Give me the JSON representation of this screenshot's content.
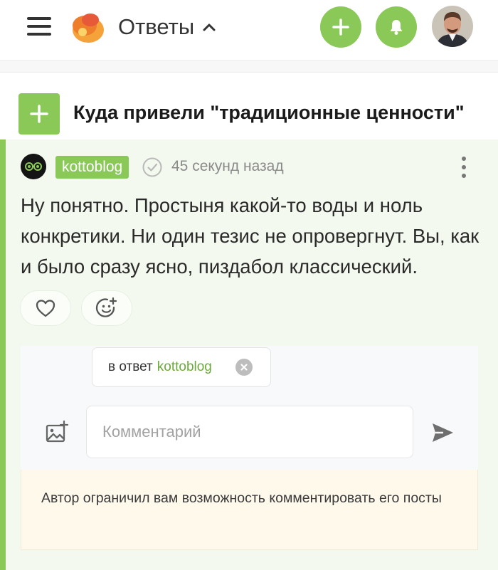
{
  "header": {
    "section_label": "Ответы",
    "colors": {
      "accent": "#8ac858"
    },
    "icons": [
      "menu-icon",
      "logo",
      "chevron-up-icon",
      "plus-icon",
      "bell-icon",
      "user-avatar"
    ]
  },
  "post": {
    "title": "Куда привели \"традиционные ценности\""
  },
  "comment": {
    "author": "kottoblog",
    "time": "45 секунд назад",
    "text": "Ну понятно. Простыня какой-то воды и ноль конкретики. Ни один тезис не опровергнут. Вы, как и было сразу ясно, пиздабол классический."
  },
  "reply": {
    "prefix": "в ответ",
    "to": "kottoblog",
    "placeholder": "Комментарий"
  },
  "notice": {
    "text": "Автор ограничил вам возможность комментировать его посты"
  }
}
